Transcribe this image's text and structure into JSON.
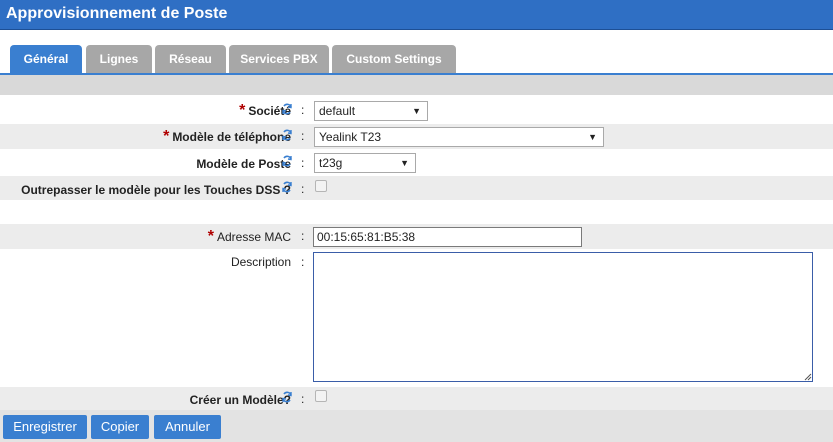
{
  "window": {
    "title": "Approvisionnement de Poste"
  },
  "tabs": [
    {
      "label": "Général",
      "active": true
    },
    {
      "label": "Lignes",
      "active": false
    },
    {
      "label": "Réseau",
      "active": false
    },
    {
      "label": "Services PBX",
      "active": false
    },
    {
      "label": "Custom Settings",
      "active": false
    }
  ],
  "form": {
    "colon": ":",
    "required_marker": "*",
    "societe": {
      "label": "Société",
      "value": "default"
    },
    "modele_telephone": {
      "label": "Modèle de téléphone",
      "value": "Yealink T23"
    },
    "modele_poste": {
      "label": "Modèle de Poste",
      "value": "t23g"
    },
    "outrepasser": {
      "label": "Outrepasser le modèle pour les Touches DSS ?",
      "checked": false
    },
    "adresse_mac": {
      "label": "Adresse MAC",
      "value": "00:15:65:81:B5:38"
    },
    "description": {
      "label": "Description",
      "value": ""
    },
    "creer_modele": {
      "label": "Créer un Modèle?",
      "checked": false
    }
  },
  "buttons": {
    "save": "Enregistrer",
    "copy": "Copier",
    "cancel": "Annuler"
  },
  "colors": {
    "title_bar": "#2f6fc4",
    "tab_active": "#3a7fd0",
    "tab_inactive": "#a7a7a7",
    "required": "#b00000",
    "sync_icon": "#3a7fd0"
  },
  "icons": {
    "sync": "sync-icon",
    "dropdown": "chevron-down-icon"
  }
}
